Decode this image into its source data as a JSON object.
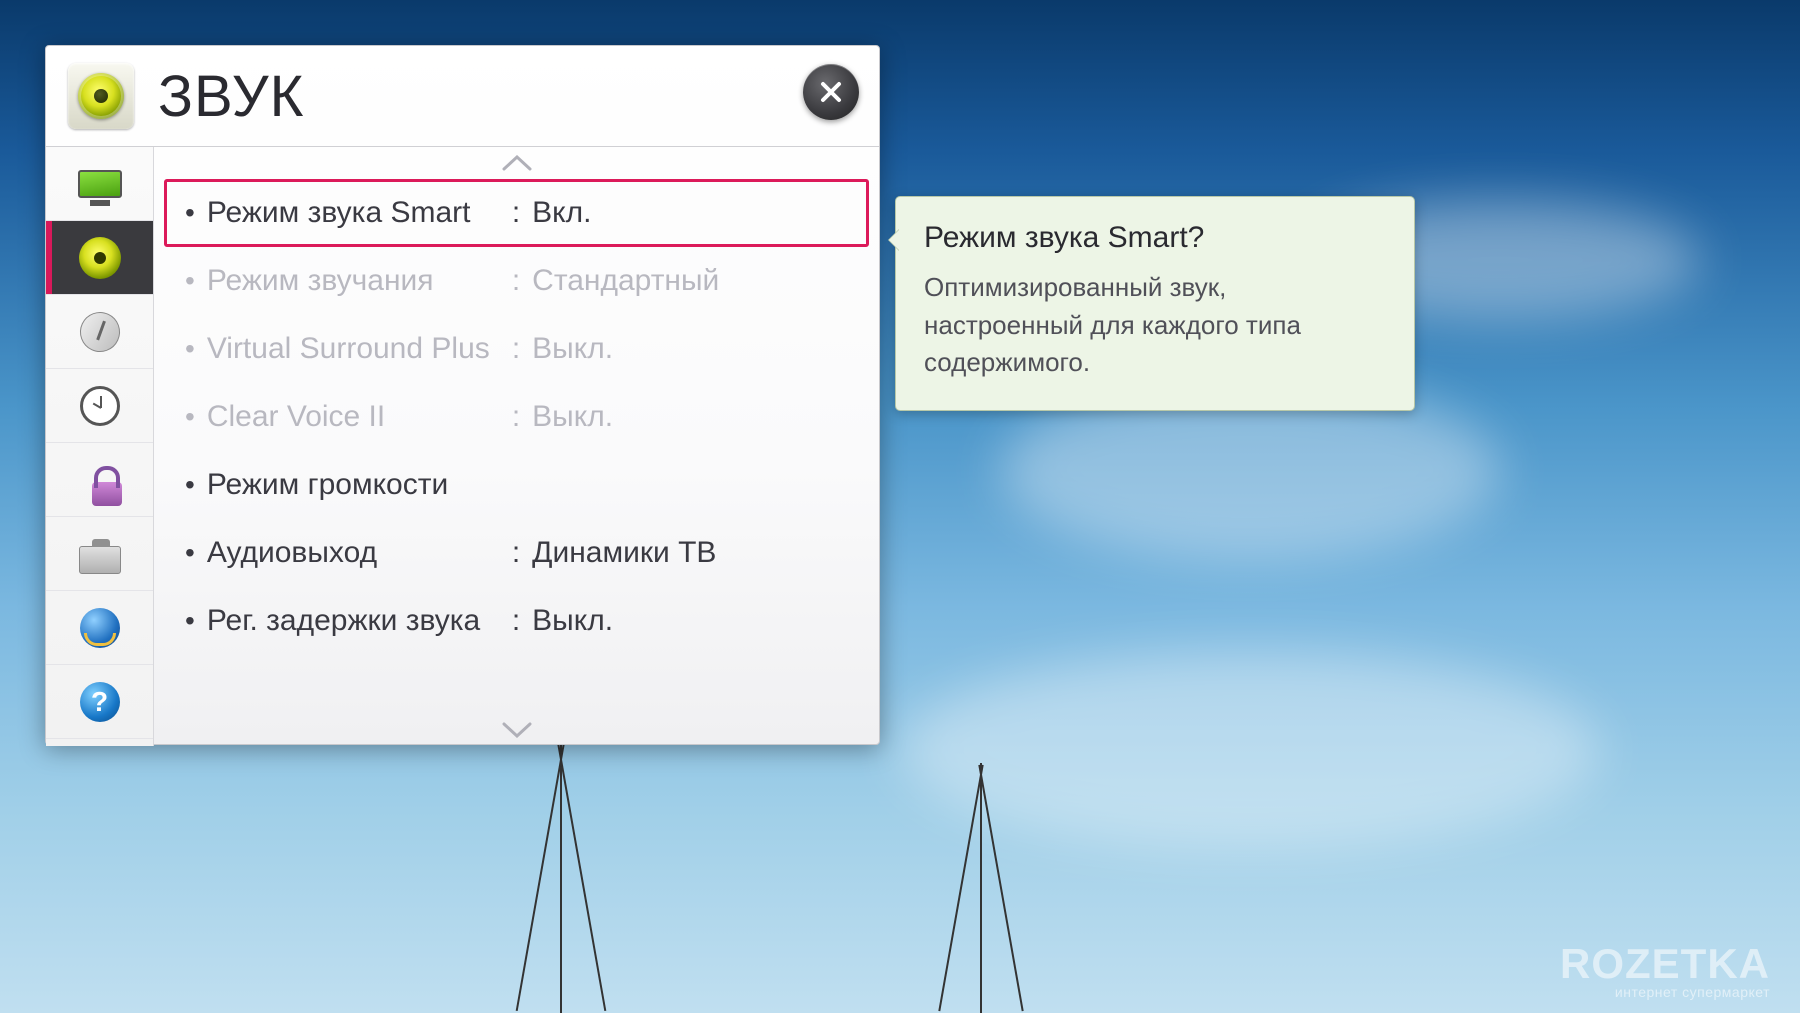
{
  "header": {
    "title": "ЗВУК"
  },
  "sidebar": {
    "items": [
      {
        "icon": "monitor-icon",
        "active": false
      },
      {
        "icon": "speaker-icon",
        "active": true
      },
      {
        "icon": "satellite-icon",
        "active": false
      },
      {
        "icon": "clock-icon",
        "active": false
      },
      {
        "icon": "lock-icon",
        "active": false
      },
      {
        "icon": "toolbox-icon",
        "active": false
      },
      {
        "icon": "network-icon",
        "active": false
      },
      {
        "icon": "help-icon",
        "active": false
      }
    ]
  },
  "settings": [
    {
      "label": "Режим звука Smart",
      "value": "Вкл.",
      "selected": true,
      "disabled": false
    },
    {
      "label": "Режим звучания",
      "value": "Стандартный",
      "selected": false,
      "disabled": true
    },
    {
      "label": "Virtual Surround Plus",
      "value": "Выкл.",
      "selected": false,
      "disabled": true
    },
    {
      "label": "Clear Voice II",
      "value": "Выкл.",
      "selected": false,
      "disabled": true
    },
    {
      "label": "Режим громкости",
      "value": null,
      "selected": false,
      "disabled": false
    },
    {
      "label": "Аудиовыход",
      "value": "Динамики ТВ",
      "selected": false,
      "disabled": false
    },
    {
      "label": "Рег. задержки звука",
      "value": "Выкл.",
      "selected": false,
      "disabled": false
    }
  ],
  "tooltip": {
    "title": "Режим звука Smart?",
    "body": "Оптимизированный звук, настроенный для каждого типа содержимого."
  },
  "watermark": {
    "brand": "ROZETKA",
    "tagline": "интернет супермаркет"
  }
}
